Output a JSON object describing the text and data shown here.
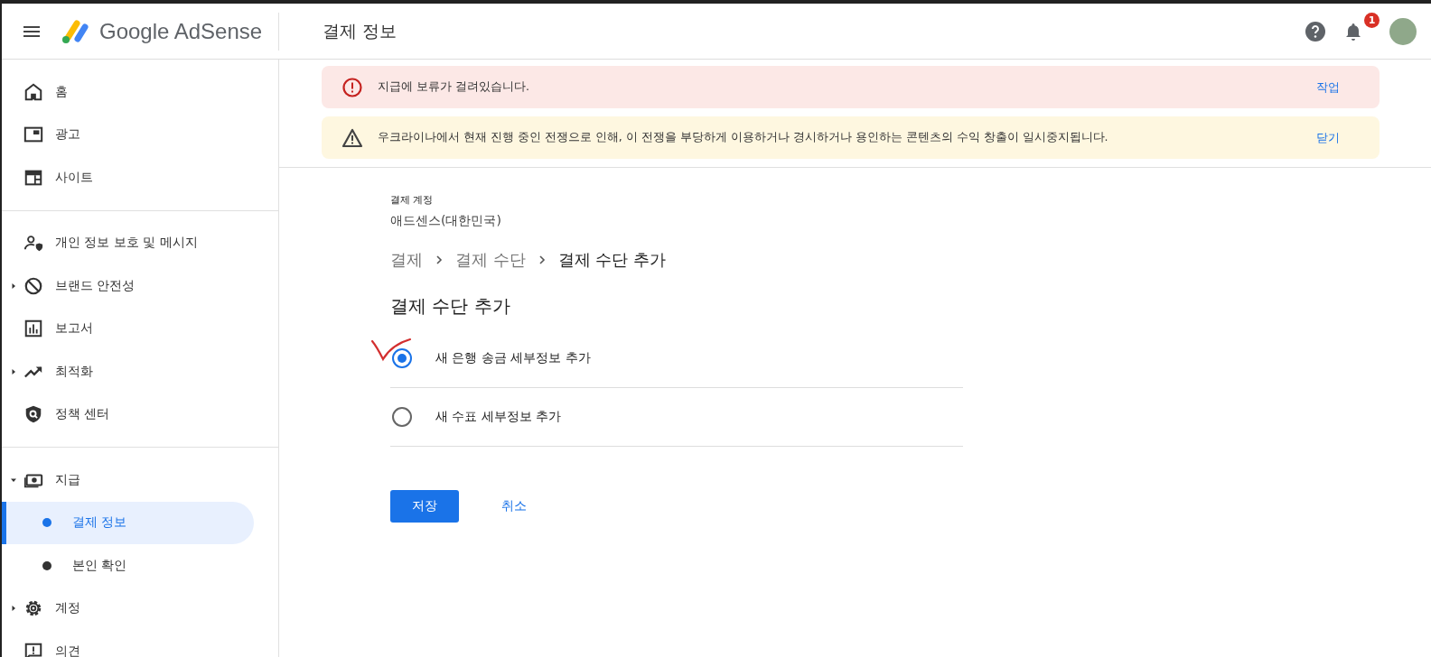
{
  "header": {
    "logo_text": "Google AdSense",
    "page_title": "결제 정보",
    "notification_count": "1"
  },
  "sidebar": {
    "sections": [
      [
        {
          "label": "홈"
        },
        {
          "label": "광고"
        },
        {
          "label": "사이트"
        }
      ],
      [
        {
          "label": "개인 정보 보호 및 메시지"
        },
        {
          "label": "브랜드 안전성",
          "expanded": false
        },
        {
          "label": "보고서"
        },
        {
          "label": "최적화",
          "expanded": false
        },
        {
          "label": "정책 센터"
        }
      ],
      [
        {
          "label": "지급",
          "expanded": true,
          "children": [
            {
              "label": "결제 정보",
              "selected": true
            },
            {
              "label": "본인 확인",
              "selected": false
            }
          ]
        },
        {
          "label": "계정",
          "expanded": false
        },
        {
          "label": "의견"
        }
      ]
    ]
  },
  "alerts": [
    {
      "kind": "error",
      "message": "지급에 보류가 걸려있습니다.",
      "action": "작업"
    },
    {
      "kind": "warning",
      "message": "우크라이나에서 현재 진행 중인 전쟁으로 인해, 이 전쟁을 부당하게 이용하거나 경시하거나 용인하는 콘텐츠의 수익 창출이 일시중지됩니다.",
      "action": "닫기"
    }
  ],
  "account": {
    "label": "결제 계정",
    "value": "애드센스(대한민국)"
  },
  "breadcrumb": [
    "결제",
    "결제 수단",
    "결제 수단 추가"
  ],
  "heading": "결제 수단 추가",
  "options": [
    {
      "label": "새 은행 송금 세부정보 추가",
      "selected": true
    },
    {
      "label": "새 수표 세부정보 추가",
      "selected": false
    }
  ],
  "buttons": {
    "save": "저장",
    "cancel": "취소"
  }
}
